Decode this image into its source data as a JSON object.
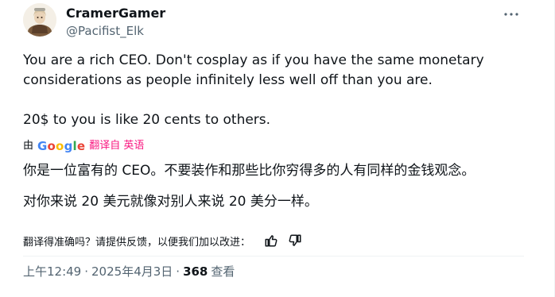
{
  "author": {
    "display_name": "CramerGamer",
    "handle": "@Pacifist_Elk"
  },
  "tweet": {
    "original_text": "You are a rich CEO. Don't cosplay as if you have the same monetary considerations as people infinitely less well off than you are.\n\n20$ to you is like 20 cents to others.",
    "translated_by_prefix": "由",
    "translated_by_brand": "Google",
    "translate_from_label": "翻译自 英语",
    "translated_paragraph_1": "你是一位富有的 CEO。不要装作和那些比你穷得多的人有同样的金钱观念。",
    "translated_paragraph_2": "对你来说 20 美元就像对别人来说 20 美分一样。"
  },
  "feedback": {
    "prompt": "翻译得准确吗？请提供反馈，以便我们加以改进："
  },
  "meta": {
    "time": "上午12:49",
    "date": "2025年4月3日",
    "separator": "·",
    "views_count": "368",
    "views_label": "查看"
  },
  "colors": {
    "primary_text": "#0f1419",
    "secondary_text": "#536471",
    "translate_link": "#f91880",
    "divider": "#eff3f4",
    "google_blue": "#4285F4",
    "google_red": "#EA4335",
    "google_yellow": "#FBBC05",
    "google_green": "#34A853"
  },
  "icons": {
    "more": "more-horizontal-icon",
    "thumbs_up": "thumbs-up-icon",
    "thumbs_down": "thumbs-down-icon"
  }
}
